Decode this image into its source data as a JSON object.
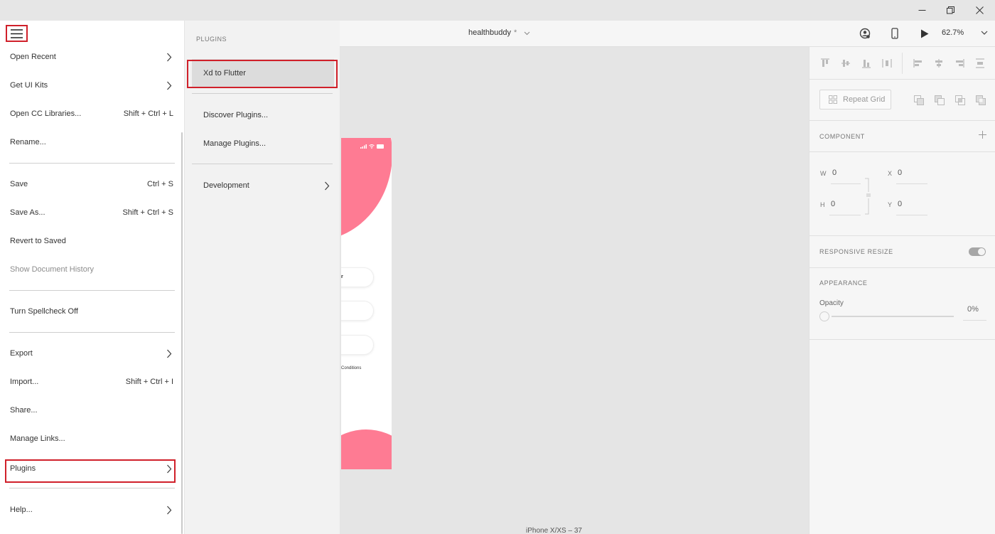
{
  "window": {
    "controls": [
      "minimize-icon",
      "restore-icon",
      "close-icon"
    ]
  },
  "header": {
    "doc_title": "healthbuddy",
    "dirty_mark": "*",
    "zoom": "62.7%",
    "icons": [
      "account-icon",
      "device-preview-icon",
      "play-icon",
      "chevron-down-icon"
    ]
  },
  "menu": {
    "items": [
      {
        "label": "Open Recent",
        "shortcut": "",
        "submenu": true
      },
      {
        "label": "Get UI Kits",
        "shortcut": "",
        "submenu": true
      },
      {
        "label": "Open CC Libraries...",
        "shortcut": "Shift + Ctrl + L",
        "submenu": false
      },
      {
        "label": "Rename...",
        "shortcut": "",
        "submenu": false
      },
      {
        "label": "Save",
        "shortcut": "Ctrl + S",
        "submenu": false
      },
      {
        "label": "Save As...",
        "shortcut": "Shift + Ctrl + S",
        "submenu": false
      },
      {
        "label": "Revert to Saved",
        "shortcut": "",
        "submenu": false
      },
      {
        "label": "Show Document History",
        "shortcut": "",
        "submenu": false,
        "disabled": true
      },
      {
        "label": "Turn Spellcheck Off",
        "shortcut": "",
        "submenu": false
      },
      {
        "label": "Export",
        "shortcut": "",
        "submenu": true
      },
      {
        "label": "Import...",
        "shortcut": "Shift + Ctrl + I",
        "submenu": false
      },
      {
        "label": "Share...",
        "shortcut": "",
        "submenu": false
      },
      {
        "label": "Manage Links...",
        "shortcut": "",
        "submenu": false
      },
      {
        "label": "Plugins",
        "shortcut": "",
        "submenu": true,
        "highlighted": true
      },
      {
        "label": "Help...",
        "shortcut": "",
        "submenu": true
      }
    ]
  },
  "plugins_menu": {
    "heading": "PLUGINS",
    "items": [
      {
        "label": "Xd to Flutter",
        "active": true
      },
      {
        "label": "Discover Plugins..."
      },
      {
        "label": "Manage Plugins..."
      },
      {
        "label": "Development",
        "submenu": true
      }
    ]
  },
  "canvas": {
    "artboard_name": "iPhone X/XS – 37",
    "artboard_field_text": "r",
    "artboard_footer_text": "Conditions",
    "accent_color": "#fe7b93"
  },
  "properties": {
    "repeat_grid_label": "Repeat Grid",
    "component_title": "COMPONENT",
    "w_label": "W",
    "w_value": "0",
    "h_label": "H",
    "h_value": "0",
    "x_label": "X",
    "x_value": "0",
    "y_label": "Y",
    "y_value": "0",
    "responsive_title": "RESPONSIVE RESIZE",
    "responsive_on": true,
    "appearance_title": "APPEARANCE",
    "opacity_label": "Opacity",
    "opacity_value": "0%"
  },
  "colors": {
    "highlight": "#d0202a",
    "menu_bg": "#ffffff",
    "submenu_bg": "#f2f2f2"
  }
}
